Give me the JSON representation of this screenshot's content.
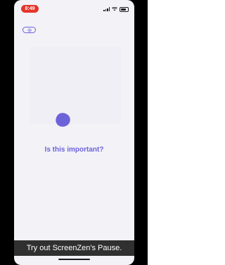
{
  "status_bar": {
    "time": "8:49",
    "icons": [
      "signal-icon",
      "wifi-icon",
      "battery-icon"
    ]
  },
  "settings_button": {
    "icon": "gear-icon"
  },
  "prompt": {
    "question": "Is this important?"
  },
  "caption": {
    "text": "Try out ScreenZen's Pause."
  },
  "colors": {
    "accent": "#6c63d9",
    "screen_background": "#f2f2f7",
    "time_pill": "#e5352b",
    "caption_background": "#141414"
  }
}
